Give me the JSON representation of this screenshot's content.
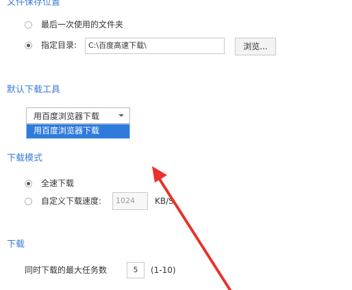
{
  "save_location": {
    "title": "文件保存位置",
    "last_used_label": "最后一次使用的文件夹",
    "specified_dir_label": "指定目录:",
    "dir_value": "C:\\百度高速下载\\",
    "browse_label": "浏览..."
  },
  "default_tool": {
    "title": "默认下载工具",
    "selected": "用百度浏览器下载",
    "options": [
      "用百度浏览器下载"
    ]
  },
  "download_mode": {
    "title": "下载模式",
    "full_speed_label": "全速下载",
    "custom_speed_label": "自定义下载速度:",
    "speed_value": "1024",
    "speed_unit": "KB/S"
  },
  "download": {
    "title": "下载",
    "max_tasks_label": "同时下载的最大任务数",
    "max_tasks_value": "5",
    "max_tasks_range": "(1-10)"
  },
  "colors": {
    "section_title": "#3a7bd5",
    "highlight": "#2f7bdb",
    "arrow": "#e8322b"
  }
}
